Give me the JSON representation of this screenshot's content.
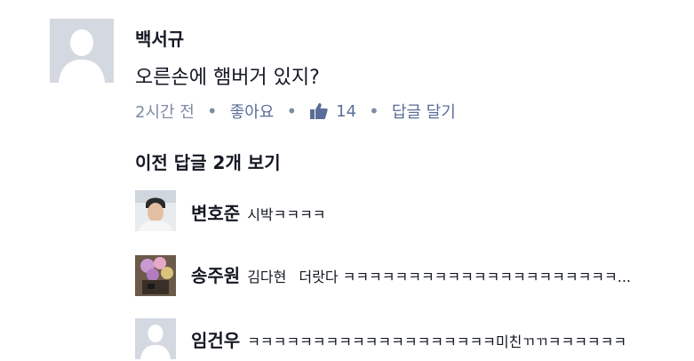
{
  "comment": {
    "author": "백서규",
    "text": "오른손에 햄버거 있지?",
    "time": "2시간 전",
    "like_label": "좋아요",
    "like_count": "14",
    "reply_label": "답글 달기"
  },
  "previous_replies_label": "이전 답글 2개 보기",
  "replies": [
    {
      "name": "변호준",
      "text": "시박ㅋㅋㅋㅋ"
    },
    {
      "name": "송주원",
      "text": "김다현",
      "text2": "더랏다 ㅋㅋㅋㅋㅋㅋㅋㅋㅋㅋㅋㅋㅋㅋㅋㅋㅋㅋㅋㅋㅋ..."
    },
    {
      "name": "임건우",
      "text": "ㅋㅋㅋㅋㅋㅋㅋㅋㅋㅋㅋㅋㅋㅋㅋㅋㅋㅋㅋ미친ㄲㄲㅋㅋㅋㅋㅋㅋ"
    }
  ],
  "colors": {
    "link": "#5b6e99",
    "meta": "#7f8ba6",
    "placeholder": "#d4d9e1"
  }
}
